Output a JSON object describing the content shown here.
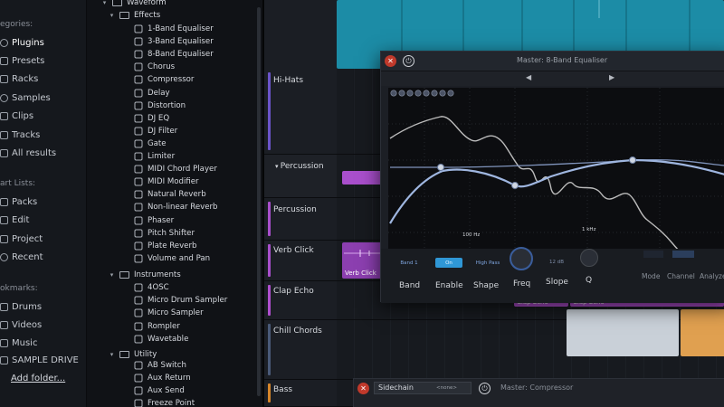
{
  "left_panel": {
    "categories_heading": "egories:",
    "categories": [
      {
        "label": "Plugins",
        "icon": "plug-icon",
        "active": true
      },
      {
        "label": "Presets",
        "icon": "preset-icon"
      },
      {
        "label": "Racks",
        "icon": "rack-icon"
      },
      {
        "label": "Samples",
        "icon": "samples-icon"
      },
      {
        "label": "Clips",
        "icon": "clips-icon"
      },
      {
        "label": "Tracks",
        "icon": "tracks-icon"
      },
      {
        "label": "All results",
        "icon": "results-icon"
      }
    ],
    "smart_heading": "art Lists:",
    "smart": [
      {
        "label": "Packs",
        "icon": "packs-icon"
      },
      {
        "label": "Edit",
        "icon": "edit-icon"
      },
      {
        "label": "Project",
        "icon": "project-icon"
      },
      {
        "label": "Recent",
        "icon": "recent-icon"
      }
    ],
    "bookmarks_heading": "okmarks:",
    "bookmarks": [
      {
        "label": "Drums",
        "icon": "folder-icon"
      },
      {
        "label": "Videos",
        "icon": "folder-icon"
      },
      {
        "label": "Music",
        "icon": "folder-icon"
      },
      {
        "label": "SAMPLE DRIVE",
        "icon": "folder-icon"
      }
    ],
    "add_folder": "Add folder..."
  },
  "tree": {
    "top": "Waveform",
    "effects_label": "Effects",
    "effects": [
      "1-Band Equaliser",
      "3-Band Equaliser",
      "8-Band Equaliser",
      "Chorus",
      "Compressor",
      "Delay",
      "Distortion",
      "DJ EQ",
      "DJ Filter",
      "Gate",
      "Limiter",
      "MIDI Chord Player",
      "MIDI Modifier",
      "Natural Reverb",
      "Non-linear Reverb",
      "Phaser",
      "Pitch Shifter",
      "Plate Reverb",
      "Volume and Pan"
    ],
    "instruments_label": "Instruments",
    "instruments": [
      "4OSC",
      "Micro Drum Sampler",
      "Micro Sampler",
      "Rompler",
      "Wavetable"
    ],
    "utility_label": "Utility",
    "utility": [
      "AB Switch",
      "Aux Return",
      "Aux Send",
      "Freeze Point"
    ]
  },
  "tracks": [
    {
      "name": "Hi-Hats",
      "color": "#6b54c9"
    },
    {
      "name": "Percussion",
      "color": "#a94fcc",
      "folder": true
    },
    {
      "name": "Percussion",
      "color": "#a94fcc"
    },
    {
      "name": "Verb Click",
      "color": "#a94fcc"
    },
    {
      "name": "Clap Echo",
      "color": "#b04fcf"
    },
    {
      "name": "Chill Chords",
      "color": "#4a5a78"
    },
    {
      "name": "Bass",
      "color": "#d7862a"
    }
  ],
  "clips": {
    "verb_click": "Verb Click",
    "clap_echo": "Clap Echo",
    "clap_echo_2": "Clap Echo"
  },
  "eq": {
    "title": "Master: 8-Band Equaliser",
    "freq_labels": [
      "100 Hz",
      "1 kHz"
    ],
    "controls": {
      "band": {
        "label": "Band",
        "value": "Band 1"
      },
      "enable": {
        "label": "Enable",
        "value": "On"
      },
      "shape": {
        "label": "Shape",
        "value": "High Pass"
      },
      "freq": {
        "label": "Freq"
      },
      "slope": {
        "label": "Slope",
        "value": "12 dB"
      },
      "q": {
        "label": "Q"
      },
      "mode": {
        "label": "Mode"
      },
      "channel": {
        "label": "Channel"
      },
      "analyzer": {
        "label": "Analyzer"
      }
    }
  },
  "compressor": {
    "title": "Master: Compressor",
    "sidechain_label": "Sidechain",
    "sidechain_value": "<none>"
  },
  "colors": {
    "accent_teal": "#1a8fa8",
    "accent_purple": "#a94fcc",
    "eq_curve": "#9fb6e0",
    "analyzer": "#bcbcbc"
  }
}
